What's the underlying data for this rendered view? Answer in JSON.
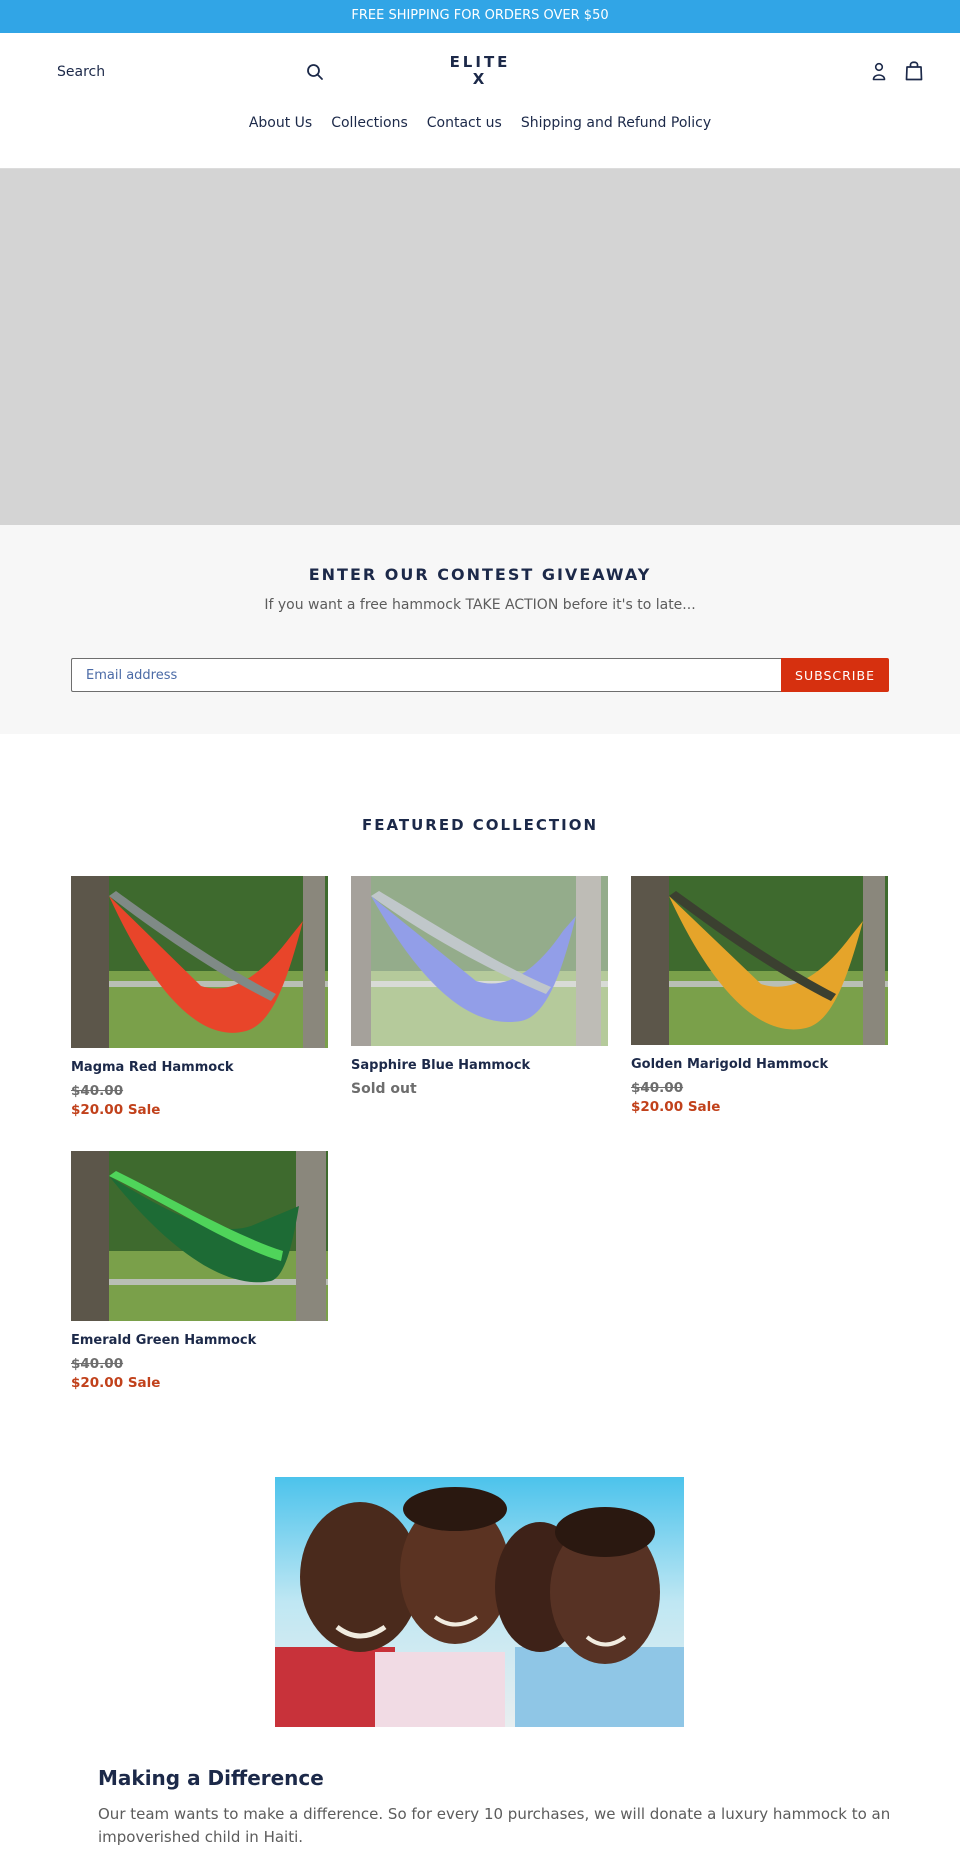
{
  "announcement": {
    "text": "FREE SHIPPING FOR ORDERS OVER $50",
    "background_color": "#31a5e6"
  },
  "header": {
    "search": {
      "placeholder": "Search",
      "value": "",
      "icon": "search-icon"
    },
    "logo": {
      "line1": "ELITE",
      "line2": "X"
    },
    "account_icon": "account-icon",
    "cart_icon": "cart-bag-icon"
  },
  "nav": {
    "items": [
      {
        "label": "About Us"
      },
      {
        "label": "Collections"
      },
      {
        "label": "Contact us"
      },
      {
        "label": "Shipping and Refund Policy"
      }
    ]
  },
  "contest": {
    "title": "ENTER OUR CONTEST GIVEAWAY",
    "subtitle": "If you want a free hammock TAKE ACTION before it's to late...",
    "email_placeholder": "Email address",
    "email_value": "",
    "subscribe_label": "SUBSCRIBE",
    "button_color": "#d6300f"
  },
  "featured": {
    "title": "FEATURED COLLECTION",
    "products": [
      {
        "title": "Magma Red Hammock",
        "compare_price": "$40.00",
        "sale_price": "$20.00",
        "sale_label": "Sale",
        "sold_out": false,
        "color": "#e8452a",
        "accent": "#7f8a86"
      },
      {
        "title": "Sapphire Blue Hammock",
        "status": "Sold out",
        "sold_out": true,
        "color": "#3a4fd6",
        "accent": "#8e9aa0"
      },
      {
        "title": "Golden Marigold Hammock",
        "compare_price": "$40.00",
        "sale_price": "$20.00",
        "sale_label": "Sale",
        "sold_out": false,
        "color": "#e5a42a",
        "accent": "#3b4030"
      },
      {
        "title": "Emerald Green Hammock",
        "compare_price": "$40.00",
        "sale_price": "$20.00",
        "sale_label": "Sale",
        "sold_out": false,
        "color": "#1d6b35",
        "accent": "#4fd45a"
      }
    ]
  },
  "difference": {
    "title": "Making a Difference",
    "text": "Our team wants to make a difference. So for every 10 purchases, we will donate a luxury hammock to an impoverished child in Haiti."
  },
  "colors": {
    "text_primary": "#1c2949",
    "sale": "#c1411b",
    "muted": "#6d6d6d"
  }
}
